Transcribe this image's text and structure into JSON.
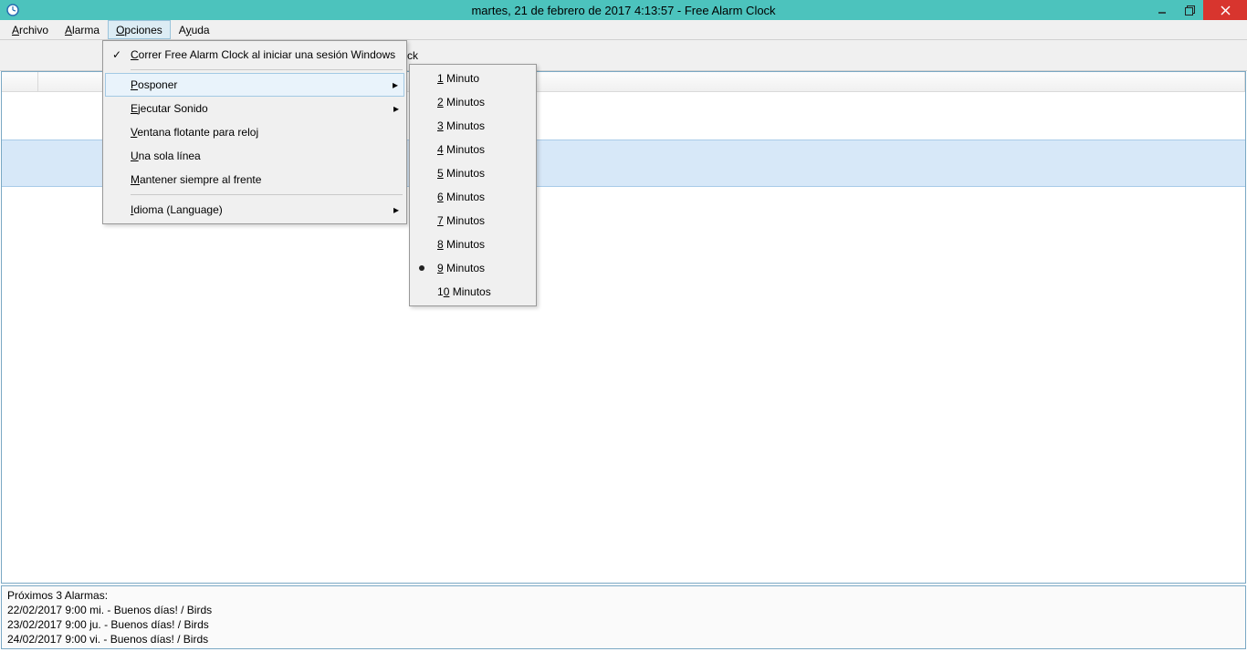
{
  "title": "martes, 21 de febrero de 2017 4:13:57  - Free Alarm Clock",
  "menubar": {
    "archivo": "Archivo",
    "alarma": "Alarma",
    "opciones": "Opciones",
    "ayuda": "Ayuda"
  },
  "toolbar": {
    "hot_alarm": "Hot Alarm Clock"
  },
  "options_menu": {
    "run_startup": "Correr Free Alarm Clock al iniciar una sesión Windows",
    "posponer": "Posponer",
    "ejecutar_sonido": "Ejecutar Sonido",
    "ventana_flotante": "Ventana flotante para reloj",
    "una_sola_linea": "Una sola línea",
    "mantener_frente": "Mantener siempre al frente",
    "idioma": "Idioma (Language)"
  },
  "posponer_menu": {
    "m1": "1 Minuto",
    "m2": "2 Minutos",
    "m3": "3 Minutos",
    "m4": "4 Minutos",
    "m5": "5 Minutos",
    "m6": "6 Minutos",
    "m7": "7 Minutos",
    "m8": "8 Minutos",
    "m9": "9 Minutos",
    "m10": "10 Minutos"
  },
  "status": {
    "header": "Próximos 3 Alarmas:",
    "r1": "22/02/2017 9:00  mi. - Buenos días! / Birds",
    "r2": "23/02/2017 9:00  ju. - Buenos días! / Birds",
    "r3": "24/02/2017 9:00  vi. - Buenos días! / Birds"
  }
}
